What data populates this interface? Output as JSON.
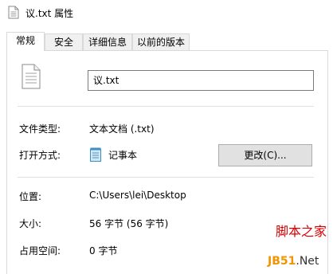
{
  "window": {
    "title": "议.txt 属性"
  },
  "tabs": [
    {
      "label": "常规",
      "active": true
    },
    {
      "label": "安全",
      "active": false
    },
    {
      "label": "详细信息",
      "active": false
    },
    {
      "label": "以前的版本",
      "active": false
    }
  ],
  "general": {
    "file_name": "议.txt",
    "type_label": "文件类型:",
    "type_value": "文本文档 (.txt)",
    "open_with_label": "打开方式:",
    "open_with_app": "记事本",
    "change_button": "更改(C)...",
    "location_label": "位置:",
    "location_value": "C:\\Users\\lei\\Desktop",
    "size_label": "大小:",
    "size_value": "56 字节 (56 字节)",
    "disk_size_label": "占用空间:",
    "disk_size_value": "0 字节"
  },
  "watermark": {
    "logo": "脚本之家",
    "site_a": "JB51",
    "site_b": ".Net"
  }
}
